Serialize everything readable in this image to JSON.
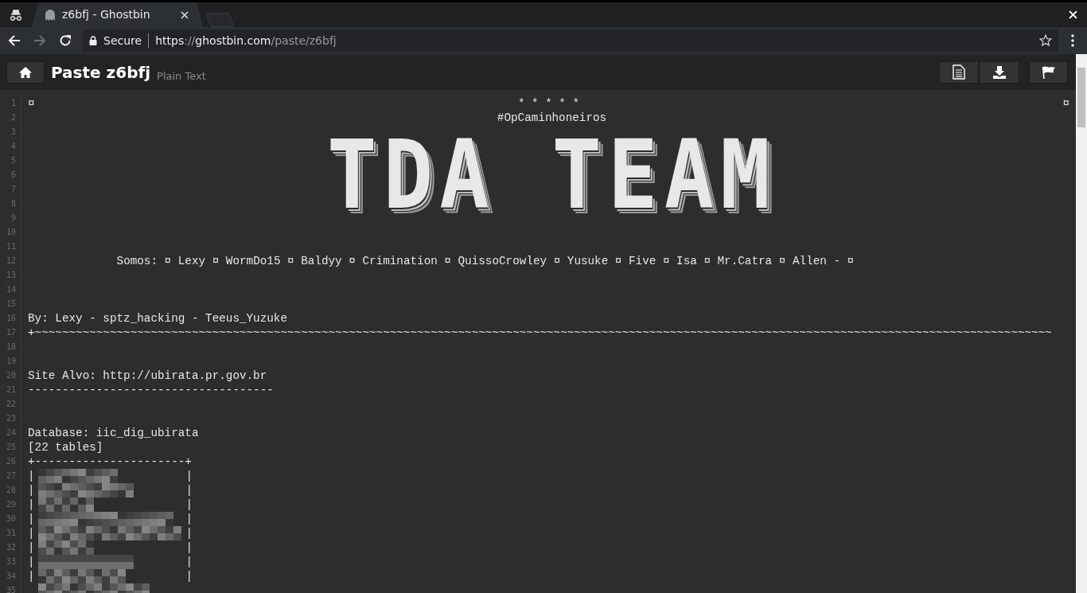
{
  "browser": {
    "tab": {
      "title": "z6bfj - Ghostbin",
      "selected": true
    },
    "forward_disabled": true,
    "address": {
      "security_label": "Secure",
      "scheme": "https",
      "separator": "://",
      "host": "ghostbin.com",
      "path": "/paste/z6bfj"
    }
  },
  "header": {
    "title": "Paste z6bfj",
    "language": "Plain Text"
  },
  "lines": [
    {
      "number": "1",
      "kind": "spread",
      "parts": [
        "¤",
        "* * * * *",
        "¤"
      ]
    },
    {
      "number": "2",
      "kind": "center",
      "text": "#OpCaminhoneiros"
    },
    {
      "kind": "banner",
      "numbers": [
        "3",
        "4",
        "5",
        "6",
        "7",
        "8",
        "9"
      ],
      "text": "TDA TEAM"
    },
    {
      "number": "10",
      "kind": "blank"
    },
    {
      "number": "11",
      "kind": "blank"
    },
    {
      "number": "12",
      "kind": "text",
      "text": "             Somos: ¤ Lexy ¤ WormDo15 ¤ Baldyy ¤ Crimination ¤ QuissoCrowley ¤ Yusuke ¤ Five ¤ Isa ¤ Mr.Catra ¤ Allen - ¤"
    },
    {
      "number": "13",
      "kind": "blank"
    },
    {
      "number": "14",
      "kind": "blank"
    },
    {
      "number": "15",
      "kind": "blank"
    },
    {
      "number": "16",
      "kind": "text",
      "text": "By: Lexy - sptz_hacking - Teeus_Yuzuke"
    },
    {
      "number": "17",
      "kind": "text",
      "text": "+~~~~~~~~~~~~~~~~~~~~~~~~~~~~~~~~~~~~~~~~~~~~~~~~~~~~~~~~~~~~~~~~~~~~~~~~~~~~~~~~~~~~~~~~~~~~~~~~~~~~~~~~~~~~~~~~~~~~~~~~~~~~~~~~~~~~~~~~~~~~~~~~~~~~~"
    },
    {
      "number": "18",
      "kind": "blank"
    },
    {
      "number": "19",
      "kind": "blank"
    },
    {
      "number": "20",
      "kind": "text",
      "text": "Site Alvo: http://ubirata.pr.gov.br"
    },
    {
      "number": "21",
      "kind": "text",
      "text": "------------------------------------"
    },
    {
      "number": "22",
      "kind": "blank"
    },
    {
      "number": "23",
      "kind": "blank"
    },
    {
      "number": "24",
      "kind": "text",
      "text": "Database: iic_dig_ubirata"
    },
    {
      "number": "25",
      "kind": "text",
      "text": "[22 tables]"
    },
    {
      "number": "26",
      "kind": "text",
      "text": "+----------------------+"
    },
    {
      "number": "27",
      "kind": "redacted",
      "left": "|",
      "right": "|"
    },
    {
      "number": "28",
      "kind": "redacted",
      "left": "|",
      "right": "|"
    },
    {
      "number": "29",
      "kind": "redacted",
      "left": "|",
      "right": "|"
    },
    {
      "number": "30",
      "kind": "redacted",
      "left": "|",
      "right": "|"
    },
    {
      "number": "31",
      "kind": "redacted",
      "left": "|",
      "right": "|"
    },
    {
      "number": "32",
      "kind": "redacted",
      "left": "|",
      "right": "|"
    },
    {
      "number": "33",
      "kind": "redacted",
      "left": "|",
      "right": "|"
    },
    {
      "number": "34",
      "kind": "redacted",
      "left": "|",
      "right": "|"
    },
    {
      "number": "35",
      "kind": "redacted"
    }
  ]
}
